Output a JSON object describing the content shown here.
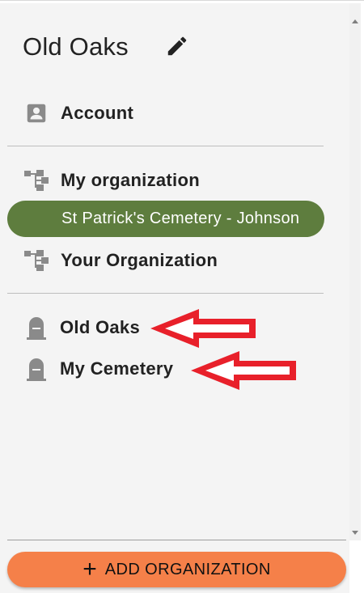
{
  "header": {
    "title": "Old Oaks",
    "edit_icon": "pencil-icon"
  },
  "nav": {
    "account": {
      "label": "Account",
      "icon": "account-box-icon"
    },
    "organizations": [
      {
        "label": "My organization",
        "icon": "org-tree-icon"
      },
      {
        "label": "St Patrick's Cemetery - Johnson",
        "selected": true
      },
      {
        "label": "Your Organization",
        "icon": "org-tree-icon"
      }
    ],
    "cemeteries": [
      {
        "label": "Old Oaks",
        "icon": "headstone-icon"
      },
      {
        "label": "My Cemetery",
        "icon": "headstone-icon"
      }
    ]
  },
  "footer": {
    "add_button_label": "ADD ORGANIZATION",
    "add_button_icon": "plus-icon"
  },
  "colors": {
    "selected_bg": "#5e7d3e",
    "add_button_bg": "#f58049",
    "annotation_arrow": "#e8202a",
    "icon_gray": "#8a8a8a"
  }
}
